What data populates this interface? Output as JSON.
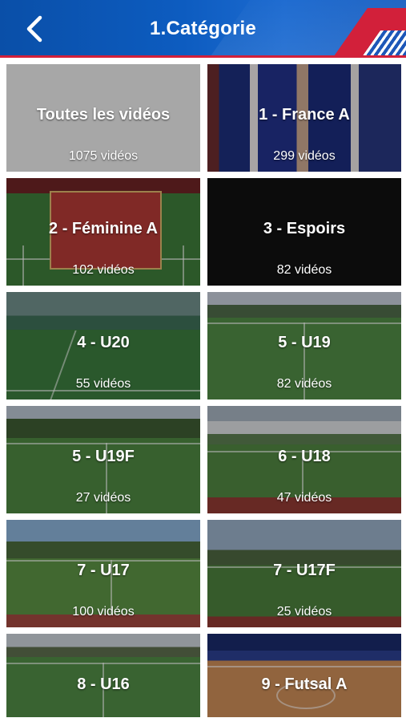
{
  "header": {
    "title": "1.Catégorie",
    "back_icon": "chevron-left-icon",
    "colors": {
      "primary": "#0d5cc0",
      "accent": "#d2203a"
    }
  },
  "categories": [
    {
      "name": "Toutes les vidéos",
      "count": "1075 vidéos"
    },
    {
      "name": "1 - France A",
      "count": "299 vidéos"
    },
    {
      "name": "2 - Féminine A",
      "count": "102 vidéos"
    },
    {
      "name": "3 - Espoirs",
      "count": "82 vidéos"
    },
    {
      "name": "4 - U20",
      "count": "55 vidéos"
    },
    {
      "name": "5 - U19",
      "count": "82 vidéos"
    },
    {
      "name": "5 - U19F",
      "count": "27 vidéos"
    },
    {
      "name": "6 - U18",
      "count": "47 vidéos"
    },
    {
      "name": "7 - U17",
      "count": "100 vidéos"
    },
    {
      "name": "7 - U17F",
      "count": "25 vidéos"
    },
    {
      "name": "8 - U16",
      "count": ""
    },
    {
      "name": "9 - Futsal A",
      "count": ""
    }
  ]
}
